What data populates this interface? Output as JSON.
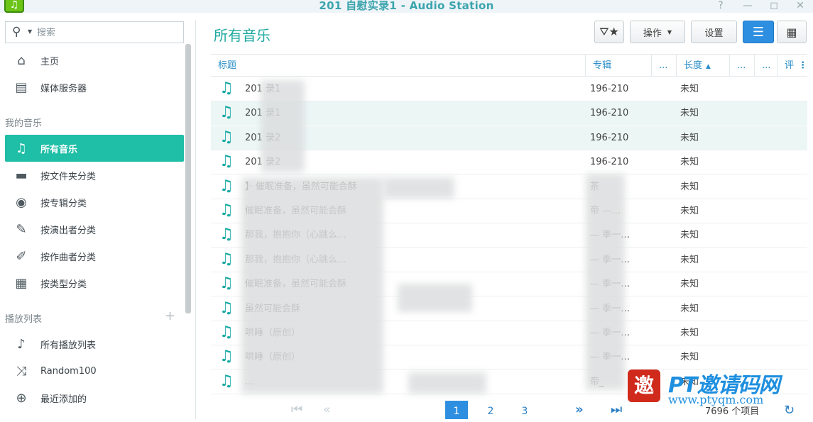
{
  "window": {
    "title": "201 自慰实录1 - Audio Station",
    "help": "?",
    "minimize": "—",
    "maximize": "◻",
    "close": "✕"
  },
  "sidebar": {
    "search_placeholder": "搜索",
    "top_items": [
      {
        "label": "主页",
        "icon": "home-icon"
      },
      {
        "label": "媒体服务器",
        "icon": "media-server-icon"
      }
    ],
    "my_music_header": "我的音乐",
    "music_items": [
      {
        "label": "所有音乐",
        "icon": "music-note-icon",
        "active": true
      },
      {
        "label": "按文件夹分类",
        "icon": "folder-icon"
      },
      {
        "label": "按专辑分类",
        "icon": "album-icon"
      },
      {
        "label": "按演出者分类",
        "icon": "microphone-icon"
      },
      {
        "label": "按作曲者分类",
        "icon": "pen-icon"
      },
      {
        "label": "按类型分类",
        "icon": "grid-icon"
      }
    ],
    "playlist_header": "播放列表",
    "add": "+",
    "playlist_items": [
      {
        "label": "所有播放列表",
        "icon": "playlist-icon"
      },
      {
        "label": "Random100",
        "icon": "shuffle-icon"
      },
      {
        "label": "最近添加的",
        "icon": "plus-circle-icon"
      }
    ]
  },
  "main": {
    "page_title": "所有音乐",
    "toolbar": {
      "filter": "filter-star-icon",
      "action_label": "操作",
      "settings_label": "设置",
      "list_view": "list-view-icon",
      "grid_view": "grid-view-icon"
    },
    "columns": [
      "标题",
      "专辑",
      "...",
      "长度",
      "...",
      "...",
      "评"
    ],
    "rows": [
      {
        "title": "201    录1",
        "album": "196-210",
        "length": "未知"
      },
      {
        "title": "201    录1",
        "album": "196-210",
        "length": "未知"
      },
      {
        "title": "201    录2",
        "album": "196-210",
        "length": "未知"
      },
      {
        "title": "201    录2",
        "album": "196-210",
        "length": "未知"
      },
      {
        "title": "】·        催眠准备，虽然可能会酥",
        "album": "茶",
        "length": "未知"
      },
      {
        "title": "催眠准备，虽然可能会酥",
        "album": "帝    —…",
        "length": "未知"
      },
      {
        "title": "那我，抱抱你（心跳么…",
        "album": "   — 季一…",
        "length": "未知"
      },
      {
        "title": "那我，抱抱你（心跳么…",
        "album": "   — 季一…",
        "length": "未知"
      },
      {
        "title": "催眠准备，虽然可能会酥",
        "album": "   — 季一…",
        "length": "未知"
      },
      {
        "title": "虽然可能会酥",
        "album": "   — 季一…",
        "length": "未知"
      },
      {
        "title": "哄睡（原创）",
        "album": "   — 季一…",
        "length": "未知"
      },
      {
        "title": "哄睡（原创）",
        "album": "   — 季一…",
        "length": "未知"
      },
      {
        "title": "…",
        "album": "帝_",
        "length": "未知"
      }
    ]
  },
  "pager": {
    "pages": [
      "1",
      "2",
      "3"
    ],
    "current": 1,
    "count": "7696 个项目"
  },
  "watermark": {
    "logo": "邀",
    "text": "PT邀请码网",
    "url": "www.ptyqm.com"
  }
}
